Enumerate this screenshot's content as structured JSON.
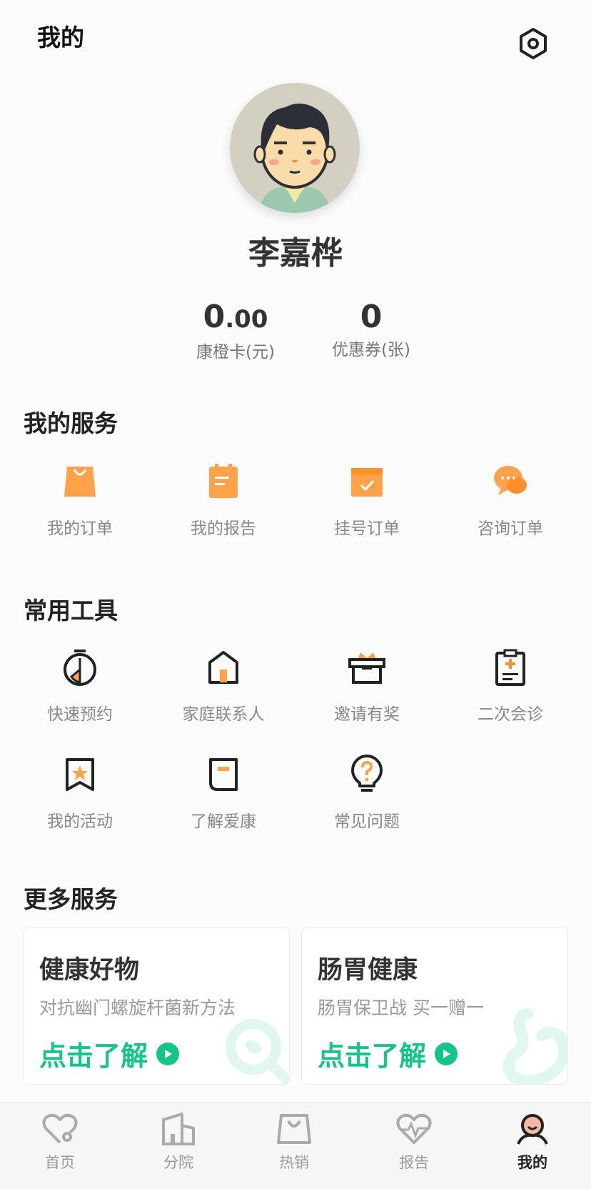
{
  "header": {
    "title": "我的"
  },
  "profile": {
    "name": "李嘉桦"
  },
  "stats": {
    "card_balance_int": "0",
    "card_balance_dec": ".00",
    "card_label": "康橙卡(元)",
    "coupons": "0",
    "coupons_label": "优惠券(张)"
  },
  "services": {
    "title": "我的服务",
    "items": [
      {
        "label": "我的订单",
        "icon": "shopping-bag-icon"
      },
      {
        "label": "我的报告",
        "icon": "report-icon"
      },
      {
        "label": "挂号订单",
        "icon": "calendar-icon"
      },
      {
        "label": "咨询订单",
        "icon": "chat-icon"
      }
    ]
  },
  "tools": {
    "title": "常用工具",
    "items": [
      {
        "label": "快速预约",
        "icon": "stopwatch-icon"
      },
      {
        "label": "家庭联系人",
        "icon": "home-icon"
      },
      {
        "label": "邀请有奖",
        "icon": "gift-box-icon"
      },
      {
        "label": "二次会诊",
        "icon": "clipboard-plus-icon"
      },
      {
        "label": "我的活动",
        "icon": "star-ribbon-icon"
      },
      {
        "label": "了解爱康",
        "icon": "tag-icon"
      },
      {
        "label": "常见问题",
        "icon": "question-bulb-icon"
      }
    ]
  },
  "more": {
    "title": "更多服务",
    "cards": [
      {
        "title": "健康好物",
        "subtitle": "对抗幽门螺旋杆菌新方法",
        "cta": "点击了解"
      },
      {
        "title": "肠胃健康",
        "subtitle": "肠胃保卫战 买一赠一",
        "cta": "点击了解"
      }
    ]
  },
  "tabbar": {
    "items": [
      {
        "label": "首页",
        "icon": "heart-stethoscope-icon"
      },
      {
        "label": "分院",
        "icon": "building-icon"
      },
      {
        "label": "热销",
        "icon": "bag-icon"
      },
      {
        "label": "报告",
        "icon": "heart-pulse-icon"
      },
      {
        "label": "我的",
        "icon": "user-icon",
        "active": true
      }
    ]
  },
  "colors": {
    "accent_orange": "#ff9a3c",
    "accent_green": "#16c388"
  }
}
